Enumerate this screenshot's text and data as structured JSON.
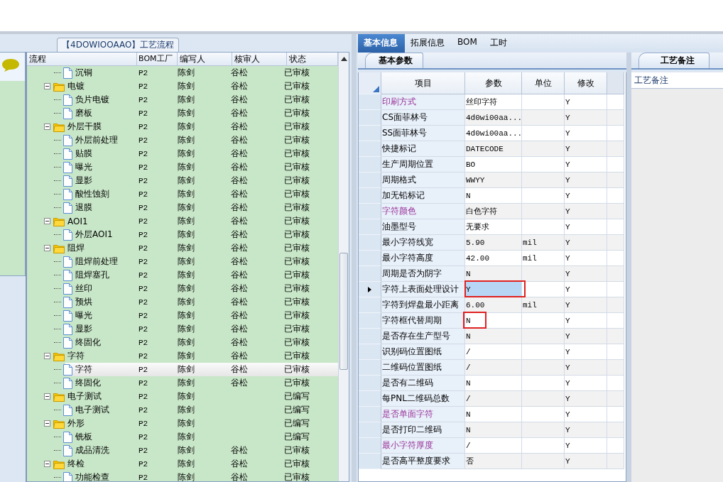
{
  "flow_panel": {
    "title": "【4DOWIOOAAO】工艺流程",
    "columns": [
      "流程",
      "BOM工厂",
      "编写人",
      "核审人",
      "状态"
    ],
    "tree": [
      {
        "kind": "file",
        "name": "沉铜",
        "bom": "P2",
        "writer": "陈剑",
        "reviewer": "谷松",
        "status": "已审核",
        "selected": false
      },
      {
        "kind": "folder",
        "name": "电镀",
        "bom": "P2",
        "writer": "陈剑",
        "reviewer": "谷松",
        "status": "已审核",
        "selected": false,
        "expanded": true,
        "children": [
          {
            "name": "负片电镀",
            "bom": "P2",
            "writer": "陈剑",
            "reviewer": "谷松",
            "status": "已审核",
            "selected": false
          },
          {
            "name": "磨板",
            "bom": "P2",
            "writer": "陈剑",
            "reviewer": "谷松",
            "status": "已审核",
            "selected": false
          }
        ]
      },
      {
        "kind": "folder",
        "name": "外层干膜",
        "bom": "P2",
        "writer": "陈剑",
        "reviewer": "谷松",
        "status": "已审核",
        "selected": false,
        "expanded": true,
        "children": [
          {
            "name": "外层前处理",
            "bom": "P2",
            "writer": "陈剑",
            "reviewer": "谷松",
            "status": "已审核",
            "selected": false
          },
          {
            "name": "贴膜",
            "bom": "P2",
            "writer": "陈剑",
            "reviewer": "谷松",
            "status": "已审核",
            "selected": false
          },
          {
            "name": "曝光",
            "bom": "P2",
            "writer": "陈剑",
            "reviewer": "谷松",
            "status": "已审核",
            "selected": false
          },
          {
            "name": "显影",
            "bom": "P2",
            "writer": "陈剑",
            "reviewer": "谷松",
            "status": "已审核",
            "selected": false
          },
          {
            "name": "酸性蚀刻",
            "bom": "P2",
            "writer": "陈剑",
            "reviewer": "谷松",
            "status": "已审核",
            "selected": false
          },
          {
            "name": "退膜",
            "bom": "P2",
            "writer": "陈剑",
            "reviewer": "谷松",
            "status": "已审核",
            "selected": false
          }
        ]
      },
      {
        "kind": "folder",
        "name": "AOI1",
        "bom": "P2",
        "writer": "陈剑",
        "reviewer": "谷松",
        "status": "已审核",
        "selected": false,
        "expanded": true,
        "children": [
          {
            "name": "外层AOI1",
            "bom": "P2",
            "writer": "陈剑",
            "reviewer": "谷松",
            "status": "已审核",
            "selected": false
          }
        ]
      },
      {
        "kind": "folder",
        "name": "阻焊",
        "bom": "P2",
        "writer": "陈剑",
        "reviewer": "谷松",
        "status": "已审核",
        "selected": false,
        "expanded": true,
        "children": [
          {
            "name": "阻焊前处理",
            "bom": "P2",
            "writer": "陈剑",
            "reviewer": "谷松",
            "status": "已审核",
            "selected": false
          },
          {
            "name": "阻焊塞孔",
            "bom": "P2",
            "writer": "陈剑",
            "reviewer": "谷松",
            "status": "已审核",
            "selected": false
          },
          {
            "name": "丝印",
            "bom": "P2",
            "writer": "陈剑",
            "reviewer": "谷松",
            "status": "已审核",
            "selected": false
          },
          {
            "name": "预烘",
            "bom": "P2",
            "writer": "陈剑",
            "reviewer": "谷松",
            "status": "已审核",
            "selected": false
          },
          {
            "name": "曝光",
            "bom": "P2",
            "writer": "陈剑",
            "reviewer": "谷松",
            "status": "已审核",
            "selected": false
          },
          {
            "name": "显影",
            "bom": "P2",
            "writer": "陈剑",
            "reviewer": "谷松",
            "status": "已审核",
            "selected": false
          },
          {
            "name": "终固化",
            "bom": "P2",
            "writer": "陈剑",
            "reviewer": "谷松",
            "status": "已审核",
            "selected": false
          }
        ]
      },
      {
        "kind": "folder",
        "name": "字符",
        "bom": "P2",
        "writer": "陈剑",
        "reviewer": "谷松",
        "status": "已审核",
        "selected": false,
        "expanded": true,
        "children": [
          {
            "name": "字符",
            "bom": "P2",
            "writer": "陈剑",
            "reviewer": "谷松",
            "status": "已审核",
            "selected": true
          },
          {
            "name": "终固化",
            "bom": "P2",
            "writer": "陈剑",
            "reviewer": "谷松",
            "status": "已审核",
            "selected": false
          }
        ]
      },
      {
        "kind": "folder",
        "name": "电子测试",
        "bom": "P2",
        "writer": "陈剑",
        "status": "已编写",
        "selected": false,
        "expanded": true,
        "children": [
          {
            "name": "电子测试",
            "bom": "P2",
            "writer": "陈剑",
            "status": "已编写",
            "selected": false
          }
        ]
      },
      {
        "kind": "folder",
        "name": "外形",
        "bom": "P2",
        "writer": "陈剑",
        "status": "已编写",
        "selected": false,
        "expanded": true,
        "children": [
          {
            "name": "铣板",
            "bom": "P2",
            "writer": "陈剑",
            "status": "已编写",
            "selected": false
          },
          {
            "name": "成品清洗",
            "bom": "P2",
            "writer": "陈剑",
            "reviewer": "谷松",
            "status": "已审核",
            "selected": false
          }
        ]
      },
      {
        "kind": "folder",
        "name": "终检",
        "bom": "P2",
        "writer": "陈剑",
        "reviewer": "谷松",
        "status": "已审核",
        "selected": false,
        "expanded": true,
        "children": [
          {
            "name": "功能检查",
            "bom": "P2",
            "writer": "陈剑",
            "reviewer": "谷松",
            "status": "已审核",
            "selected": false
          }
        ]
      }
    ]
  },
  "tabs": [
    {
      "label": "基本信息",
      "selected": true
    },
    {
      "label": "拓展信息",
      "selected": false
    },
    {
      "label": "BOM",
      "selected": false
    },
    {
      "label": "工时",
      "selected": false
    }
  ],
  "params_panel": {
    "tab": "基本参数",
    "columns": [
      "项目",
      "参数",
      "单位",
      "修改"
    ],
    "rows": [
      {
        "item": "印刷方式",
        "required": true,
        "value": "丝印字符",
        "unit": "",
        "modified": "Y",
        "current": false,
        "highlighted": false
      },
      {
        "item": "CS面菲林号",
        "required": false,
        "value": "4d0wi00aa...",
        "unit": "",
        "modified": "Y",
        "current": false,
        "highlighted": false
      },
      {
        "item": "SS面菲林号",
        "required": false,
        "value": "4d0wi00aa...",
        "unit": "",
        "modified": "Y",
        "current": false,
        "highlighted": false
      },
      {
        "item": "快捷标记",
        "required": false,
        "value": "DATECODE",
        "unit": "",
        "modified": "Y",
        "current": false,
        "highlighted": false
      },
      {
        "item": "生产周期位置",
        "required": false,
        "value": "BO",
        "unit": "",
        "modified": "Y",
        "current": false,
        "highlighted": false
      },
      {
        "item": "周期格式",
        "required": false,
        "value": "WWYY",
        "unit": "",
        "modified": "Y",
        "current": false,
        "highlighted": false
      },
      {
        "item": "加无铅标记",
        "required": false,
        "value": "N",
        "unit": "",
        "modified": "Y",
        "current": false,
        "highlighted": false
      },
      {
        "item": "字符颜色",
        "required": true,
        "value": "白色字符",
        "unit": "",
        "modified": "Y",
        "current": false,
        "highlighted": false
      },
      {
        "item": "油墨型号",
        "required": false,
        "value": "无要求",
        "unit": "",
        "modified": "Y",
        "current": false,
        "highlighted": false
      },
      {
        "item": "最小字符线宽",
        "required": false,
        "value": "5.90",
        "unit": "mil",
        "modified": "Y",
        "current": false,
        "highlighted": false
      },
      {
        "item": "最小字符高度",
        "required": false,
        "value": "42.00",
        "unit": "mil",
        "modified": "Y",
        "current": false,
        "highlighted": false
      },
      {
        "item": "周期是否为阴字",
        "required": false,
        "value": "N",
        "unit": "",
        "modified": "Y",
        "current": false,
        "highlighted": false
      },
      {
        "item": "字符上表面处理设计",
        "required": false,
        "value": "Y",
        "unit": "",
        "modified": "Y",
        "current": true,
        "highlighted": true
      },
      {
        "item": "字符到焊盘最小距离",
        "required": false,
        "value": "6.00",
        "unit": "mil",
        "modified": "Y",
        "current": false,
        "highlighted": false
      },
      {
        "item": "字符框代替周期",
        "required": false,
        "value": "N",
        "unit": "",
        "modified": "Y",
        "current": false,
        "highlighted": true
      },
      {
        "item": "是否存在生产型号",
        "required": false,
        "value": "N",
        "unit": "",
        "modified": "Y",
        "current": false,
        "highlighted": false
      },
      {
        "item": "识别码位置图纸",
        "required": false,
        "value": "/",
        "unit": "",
        "modified": "Y",
        "current": false,
        "highlighted": false
      },
      {
        "item": "二维码位置图纸",
        "required": false,
        "value": "/",
        "unit": "",
        "modified": "Y",
        "current": false,
        "highlighted": false
      },
      {
        "item": "是否有二维码",
        "required": false,
        "value": "N",
        "unit": "",
        "modified": "Y",
        "current": false,
        "highlighted": false
      },
      {
        "item": "每PNL二维码总数",
        "required": false,
        "value": "/",
        "unit": "",
        "modified": "Y",
        "current": false,
        "highlighted": false
      },
      {
        "item": "是否单面字符",
        "required": true,
        "value": "N",
        "unit": "",
        "modified": "Y",
        "current": false,
        "highlighted": false
      },
      {
        "item": "是否打印二维码",
        "required": false,
        "value": "N",
        "unit": "",
        "modified": "Y",
        "current": false,
        "highlighted": false
      },
      {
        "item": "最小字符厚度",
        "required": true,
        "value": "/",
        "unit": "",
        "modified": "Y",
        "current": false,
        "highlighted": false
      },
      {
        "item": "是否高平整度要求",
        "required": false,
        "value": "否",
        "unit": "",
        "modified": "Y",
        "current": false,
        "highlighted": false
      }
    ]
  },
  "notes_panel": {
    "tab": "工艺备注",
    "header": "工艺备注"
  }
}
